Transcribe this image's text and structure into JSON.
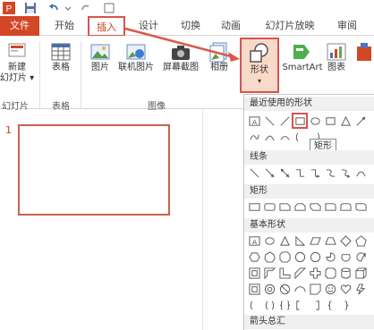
{
  "tabs": [
    "文件",
    "开始",
    "插入",
    "设计",
    "切换",
    "动画",
    "幻灯片放映",
    "审阅"
  ],
  "ribbon": {
    "new_slide": "新建\n幻灯片 ▾",
    "table": "表格",
    "picture": "图片",
    "online_picture": "联机图片",
    "screenshot": "屏幕截图",
    "album": "相册",
    "shape": "形状",
    "smartart": "SmartArt",
    "chart": "图表",
    "groups": {
      "slides": "幻灯片",
      "tables": "表格",
      "images": "图像"
    }
  },
  "slide_pane": {
    "slide_number": "1"
  },
  "shapes_menu": {
    "recent_header": "最近使用的形状",
    "lines_header": "线条",
    "rect_header": "矩形",
    "basic_header": "基本形状",
    "arrows_header": "箭头总汇",
    "tooltip": "矩形"
  },
  "colors": {
    "accent": "#d24726",
    "highlight": "#d9534f",
    "arrow": "#d85a4a"
  },
  "icons": {
    "save": "save-icon",
    "undo": "undo-icon",
    "redo": "redo-icon"
  }
}
